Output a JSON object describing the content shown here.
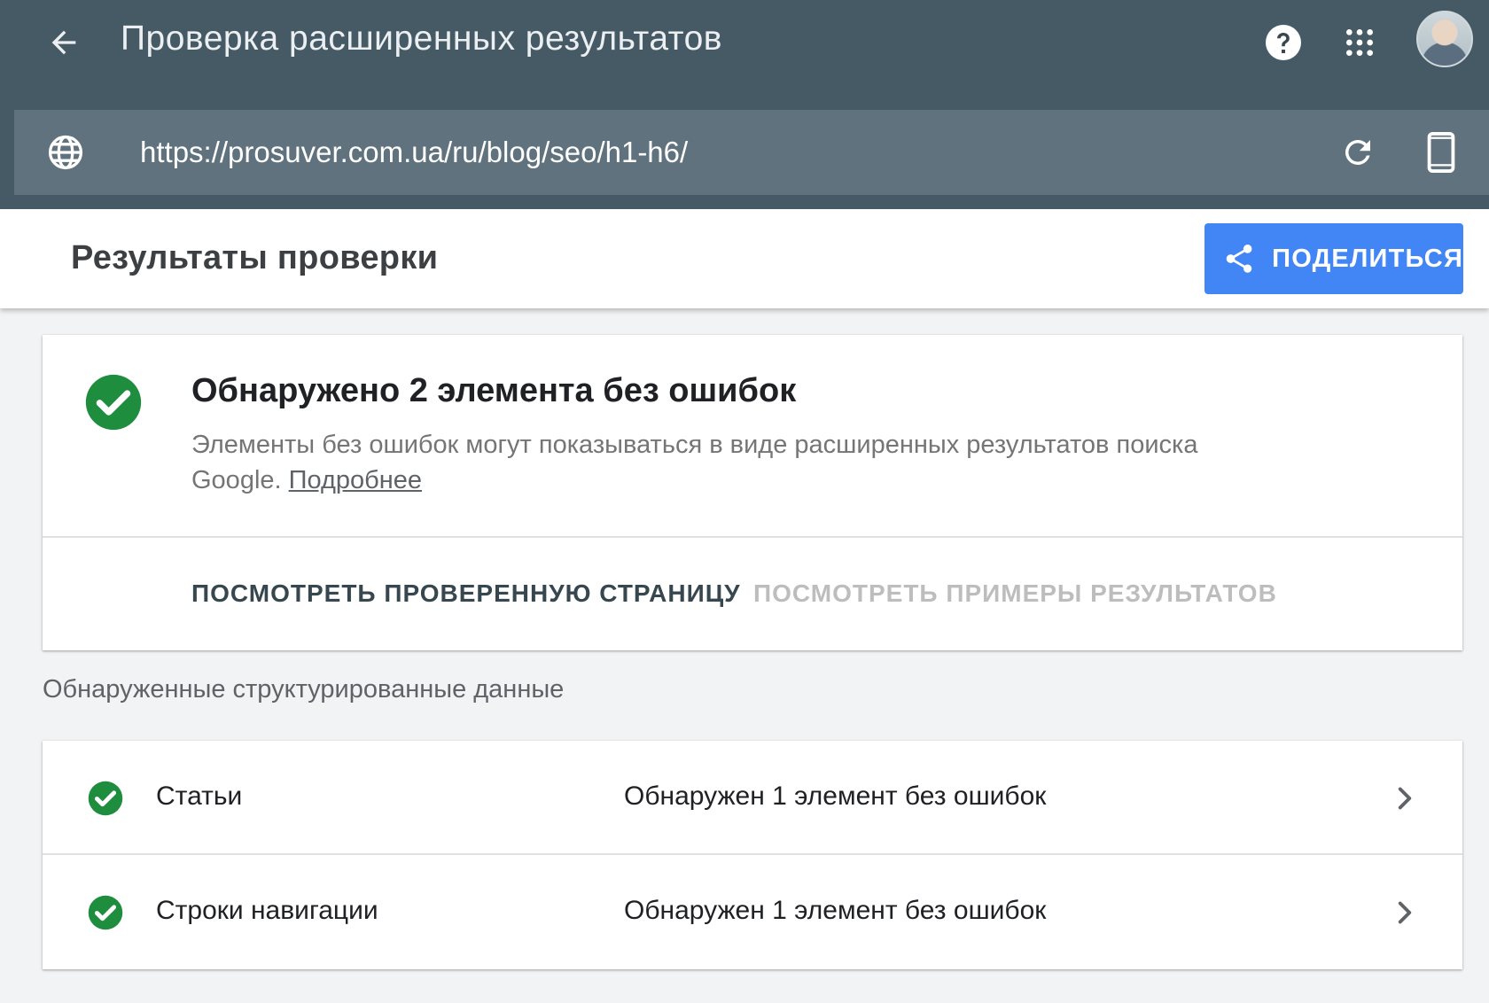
{
  "app": {
    "title": "Проверка расширенных результатов"
  },
  "url_bar": {
    "url": "https://prosuver.com.ua/ru/blog/seo/h1-h6/"
  },
  "icons": {
    "back": "arrow-back-icon",
    "help": "help-icon",
    "apps": "apps-grid-icon",
    "globe": "globe-icon",
    "reload": "reload-icon",
    "device": "smartphone-icon",
    "share": "share-icon",
    "check": "check-circle-icon",
    "chevron": "chevron-right-icon"
  },
  "colors": {
    "header_bg": "#455a64",
    "url_bar_bg": "#5f727d",
    "accent": "#4285f4",
    "success": "#1e8e3e"
  },
  "results": {
    "title": "Результаты проверки",
    "share_label": "ПОДЕЛИТЬСЯ"
  },
  "summary": {
    "heading": "Обнаружено 2 элемента без ошибок",
    "description": "Элементы без ошибок могут показываться в виде расширенных результатов поиска Google.",
    "learn_more": "Подробнее",
    "actions": [
      "ПОСМОТРЕТЬ ПРОВЕРЕННУЮ СТРАНИЦУ",
      "ПОСМОТРЕТЬ ПРИМЕРЫ РЕЗУЛЬТАТОВ"
    ]
  },
  "detected": {
    "label": "Обнаруженные структурированные данные",
    "items": [
      {
        "name": "Статьи",
        "status": "Обнаружен 1 элемент без ошибок"
      },
      {
        "name": "Строки навигации",
        "status": "Обнаружен 1 элемент без ошибок"
      }
    ]
  }
}
